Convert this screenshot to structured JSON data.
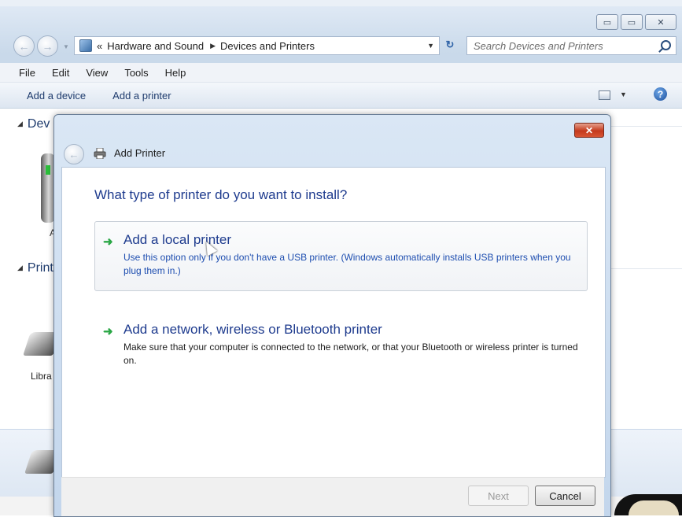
{
  "window": {
    "controls": {
      "minimize": "▭",
      "maximize": "▭",
      "close": "✕"
    }
  },
  "nav": {
    "address_prefix": "«",
    "breadcrumbs": [
      "Hardware and Sound",
      "Devices and Printers"
    ],
    "search_placeholder": "Search Devices and Printers"
  },
  "menu": [
    "File",
    "Edit",
    "View",
    "Tools",
    "Help"
  ],
  "commands": {
    "add_device": "Add a device",
    "add_printer": "Add a printer"
  },
  "groups": {
    "devices": "Dev",
    "printers": "Print"
  },
  "background_labels": {
    "device_fragment": "A",
    "printer_fragment": "Libra"
  },
  "dialog": {
    "title": "Add Printer",
    "close": "✕",
    "heading": "What type of printer do you want to install?",
    "options": [
      {
        "title": "Add a local printer",
        "description": "Use this option only if you don't have a USB printer. (Windows automatically installs USB printers when you plug them in.)"
      },
      {
        "title": "Add a network, wireless or Bluetooth printer",
        "description": "Make sure that your computer is connected to the network, or that your Bluetooth or wireless printer is turned on."
      }
    ],
    "buttons": {
      "next": "Next",
      "cancel": "Cancel"
    }
  },
  "icons": {
    "arrow": "➜",
    "help": "?",
    "back": "←"
  },
  "colors": {
    "link_blue": "#1e3b8e",
    "green_arrow": "#2aa745",
    "close_red": "#c4391c"
  }
}
